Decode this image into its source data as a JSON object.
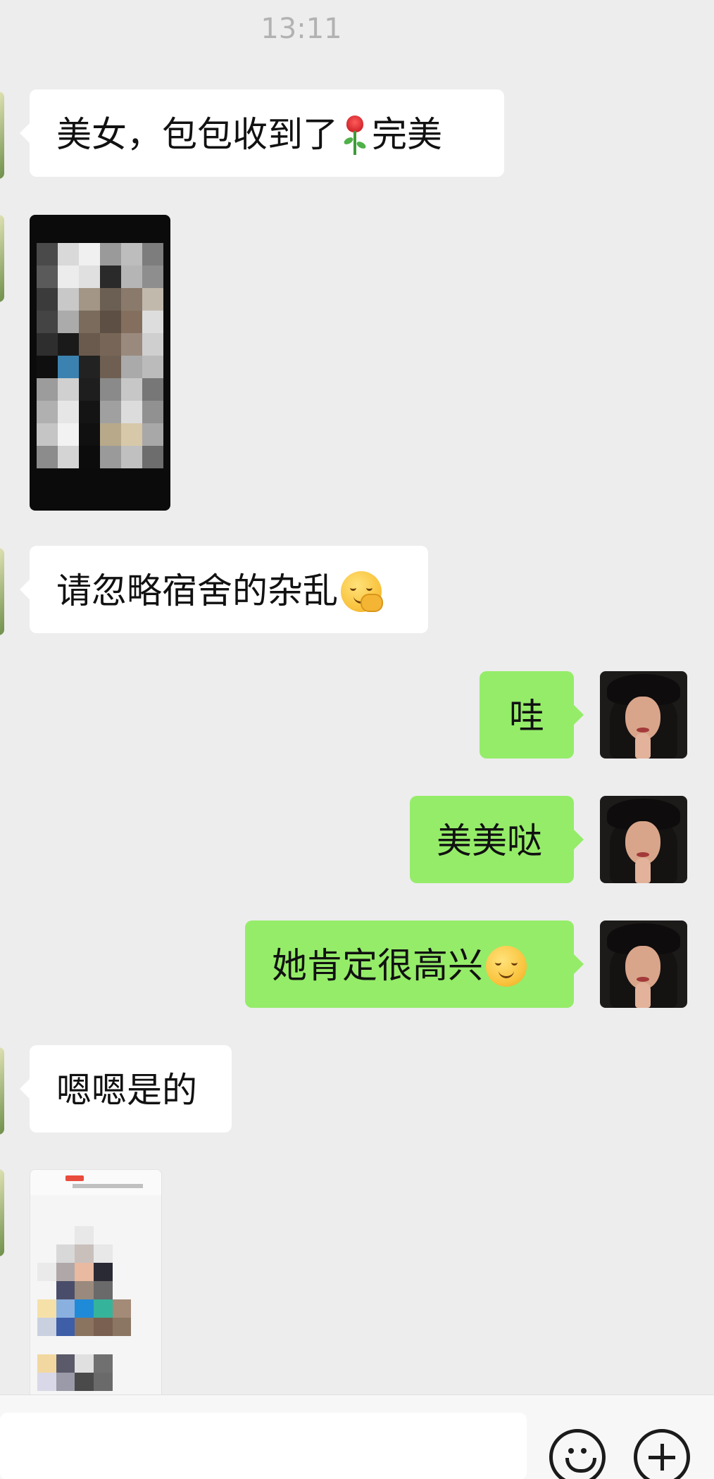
{
  "header": {
    "timestamp": "13:11"
  },
  "messages": [
    {
      "side": "left",
      "type": "text",
      "text_before": "美女，包包收到了",
      "emoji": "rose-icon",
      "text_after": "完美"
    },
    {
      "side": "left",
      "type": "image",
      "description_icon": "photo-icon"
    },
    {
      "side": "left",
      "type": "text",
      "text": "请忽略宿舍的杂乱",
      "emoji": "thinking-face-icon"
    },
    {
      "side": "right",
      "type": "text",
      "text": "哇"
    },
    {
      "side": "right",
      "type": "text",
      "text": "美美哒"
    },
    {
      "side": "right",
      "type": "text",
      "text": "她肯定很高兴",
      "emoji": "smiling-face-icon"
    },
    {
      "side": "left",
      "type": "text",
      "text": "嗯嗯是的"
    },
    {
      "side": "left",
      "type": "image",
      "description_icon": "screenshot-icon"
    }
  ],
  "input_bar": {
    "placeholder": "",
    "icons": [
      "emoji-icon",
      "plus-icon"
    ]
  },
  "colors": {
    "background": "#ededed",
    "bubble_left": "#ffffff",
    "bubble_right": "#95ec69",
    "timestamp": "#b2b2b2"
  }
}
